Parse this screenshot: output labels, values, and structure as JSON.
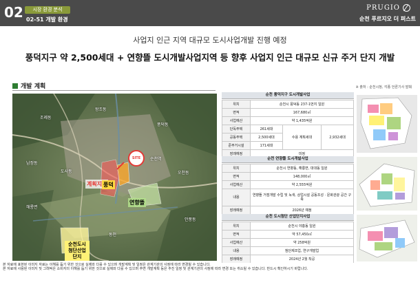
{
  "header": {
    "number": "02",
    "tag": "시장 환경 분석",
    "section": "02-51 개발 환경",
    "logo": "PRUGIO",
    "site_name": "순천 푸르지오 더 퍼스트"
  },
  "subtitle": "사업지 인근 지역 대규모 도시사업개발 진행 예정",
  "headline": "풍덕지구 약 2,500세대 + 연향뜰 도시개발사업지역 등 향후 사업지 인근 대규모 신규 주거 단지 개발",
  "dev_title": "개발 계획",
  "source_note": "※ 출처 : 순천시청, 각종 언론기사 발췌",
  "map": {
    "site_label": "SITE",
    "label_red": "계획지구",
    "label_aug": "풍덕",
    "label_green": "연향뜰",
    "label_yellow": "순천도시첨단산업단지",
    "place_labels": [
      "조례동",
      "왕조동",
      "풍덕동",
      "남정동",
      "도사동",
      "오천동",
      "해룡면",
      "안풍동",
      "순천역",
      "동천"
    ]
  },
  "tables": {
    "t1": {
      "title": "순천 풍덕지구 도시개발사업",
      "rows": [
        {
          "k": "위치",
          "v": "순천시 풍덕동 237-1번지 일원"
        },
        {
          "k": "면적",
          "v": "167,680㎡"
        },
        {
          "k": "사업예산",
          "v": "약 1,435억원"
        },
        {
          "k": "단독주택",
          "v": "261세대"
        },
        {
          "k": "공동주택",
          "v": "2,500세대"
        },
        {
          "k": "준주거시설",
          "v": "171세대"
        },
        {
          "k": "장래예정",
          "v": "미정"
        }
      ],
      "mid_label": "수용 계획세대",
      "mid_total": "2,932세대"
    },
    "t2": {
      "title": "순천 연향뜰 도시개발사업",
      "rows": [
        {
          "k": "위치",
          "v": "순천시 연향동, 해룡면, 대대동 일원"
        },
        {
          "k": "면적",
          "v": "148,000㎡"
        },
        {
          "k": "사업예산",
          "v": "약 2,555억원"
        },
        {
          "k": "내용",
          "v": "연향뜰 거점개발 수립 및 녹색, 상업시설 공동조성 · 문화관광 공간 구축"
        },
        {
          "k": "장래예정",
          "v": "2026년 예정"
        }
      ]
    },
    "t3": {
      "title": "순천 도시첨단 산업단지사업",
      "rows": [
        {
          "k": "위치",
          "v": "순천시 야흥동 일원"
        },
        {
          "k": "면적",
          "v": "약 57,450㎡"
        },
        {
          "k": "사업예산",
          "v": "약 258억원"
        },
        {
          "k": "내용",
          "v": "첨단제조업, 연구개발업"
        },
        {
          "k": "장래예정",
          "v": "2024년 2월 착공"
        }
      ]
    }
  },
  "footer": [
    "본 자료에 표현된 이미지 자료는 이해를 돕기 위한 것으로 실제와 다를 수 있으며 개발계획 및 일정은 관계기관의 사정에 따라 변경될 수 있습니다.",
    "본 자료에 사용된 이미지 및 그래픽은 소비자의 이해를 돕기 위한 것으로 실제와 다를 수 있으며 주변 개발계획 등은 추진 일정 및 관계기관의 사정에 따라 변경 또는 취소될 수 있습니다. 반드시 확인하시기 바랍니다."
  ],
  "colors": {
    "header_bg": "#4a4a4a",
    "accent_green": "#8a9a3a",
    "site_red": "#e53935"
  }
}
